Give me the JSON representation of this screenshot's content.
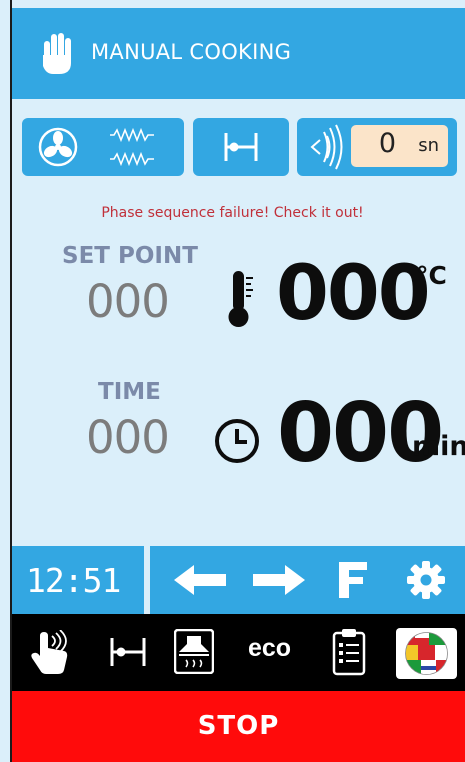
{
  "header": {
    "title": "MANUAL COOKING",
    "icon": "hand-icon"
  },
  "modes": {
    "fan_resistance": {
      "icons": [
        "fan-icon",
        "heating-element-icon"
      ]
    },
    "door": {
      "icon": "door-range-icon"
    },
    "humidity": {
      "icon": "humidity-icon",
      "value": "0",
      "unit": "sn"
    }
  },
  "alert": "Phase sequence failure! Check it out!",
  "setpoint": {
    "label": "SET POINT",
    "set_value": "000",
    "current_value": "000",
    "unit": "°C",
    "icon": "thermometer-icon"
  },
  "time": {
    "label": "TIME",
    "set_value": "000",
    "current_value": "000",
    "unit": "min",
    "icon": "clock-icon"
  },
  "bottom_bar": {
    "clock": "12:51",
    "buttons": [
      {
        "name": "arrow-left-icon"
      },
      {
        "name": "arrow-right-icon"
      },
      {
        "name": "f-icon"
      },
      {
        "name": "gear-icon"
      }
    ]
  },
  "functions": {
    "eco_label": "eco",
    "items": [
      "touch-icon",
      "door-range-icon",
      "hood-icon",
      "eco",
      "clipboard-icon",
      "flags-globe-icon"
    ]
  },
  "stop_label": "STOP",
  "colors": {
    "accent": "#33a7e2",
    "background": "#dbeffa",
    "alert": "#c0303a",
    "stop": "#ff0b0b",
    "humidity_field": "#fbe4c9"
  }
}
